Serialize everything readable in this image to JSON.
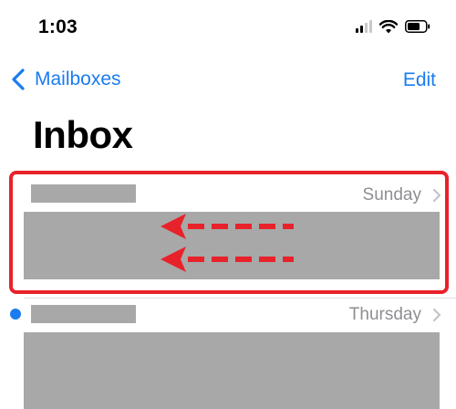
{
  "status_bar": {
    "time": "1:03"
  },
  "nav": {
    "back_label": "Mailboxes",
    "edit_label": "Edit"
  },
  "page": {
    "title": "Inbox"
  },
  "messages": [
    {
      "date": "Sunday",
      "unread": false,
      "highlighted": true
    },
    {
      "date": "Thursday",
      "unread": true,
      "highlighted": false
    }
  ],
  "colors": {
    "accent": "#1a7cf0",
    "annotation_red": "#e8222a",
    "redaction_gray": "#a8a8a8",
    "secondary_text": "#8e8e93"
  },
  "icons": {
    "signal": "signal-bars-icon",
    "wifi": "wifi-icon",
    "battery": "battery-icon",
    "back": "chevron-left-icon",
    "disclosure": "chevron-right-icon",
    "annotation": "swipe-left-arrows-icon"
  }
}
